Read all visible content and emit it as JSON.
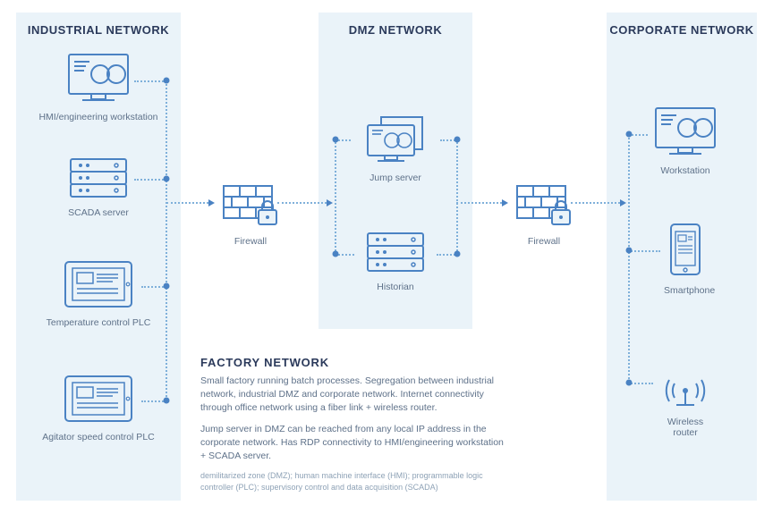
{
  "panels": {
    "industrial": {
      "title": "INDUSTRIAL NETWORK"
    },
    "dmz": {
      "title": "DMZ NETWORK"
    },
    "corporate": {
      "title": "CORPORATE NETWORK"
    }
  },
  "nodes": {
    "hmi": "HMI/engineering workstation",
    "scada": "SCADA server",
    "temp_plc": "Temperature control PLC",
    "agit_plc": "Agitator speed control PLC",
    "fw1": "Firewall",
    "jump": "Jump server",
    "historian": "Historian",
    "fw2": "Firewall",
    "workstation": "Workstation",
    "phone": "Smartphone",
    "router": "Wireless router"
  },
  "description": {
    "heading": "FACTORY NETWORK",
    "p1": "Small factory running batch processes. Segregation between industrial network, industrial DMZ and corporate network. Internet connectivity through office network using a fiber link + wireless router.",
    "p2": "Jump server in DMZ can be reached from any local IP address in the corporate network. Has RDP connectivity to HMI/engineering workstation + SCADA server.",
    "glossary": "demilitarized zone (DMZ); human machine interface (HMI); programmable logic controller (PLC); supervisory control and data acquisition  (SCADA)"
  },
  "colors": {
    "navy": "#2b3a5b",
    "blue": "#4a82c3",
    "panel": "#eaf3f9"
  }
}
